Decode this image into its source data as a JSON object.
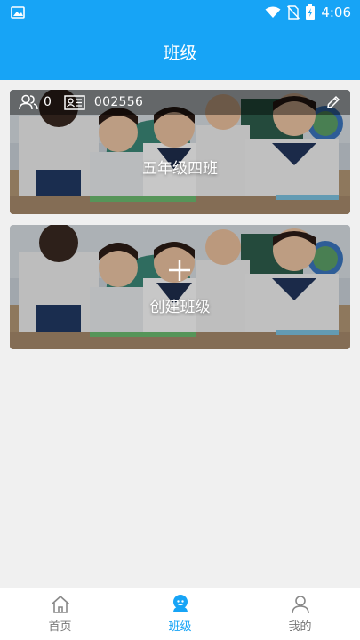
{
  "status_bar": {
    "time": "4:06",
    "icons": [
      "image-icon",
      "wifi-icon",
      "no-sim-icon",
      "battery-charging-icon"
    ]
  },
  "header": {
    "title": "班级"
  },
  "class_card": {
    "member_count": "0",
    "class_code": "002556",
    "class_name": "五年级四班",
    "icons": [
      "members-icon",
      "id-card-icon",
      "edit-icon"
    ]
  },
  "create_card": {
    "label": "创建班级",
    "icon": "plus-icon"
  },
  "bottom_nav": {
    "items": [
      {
        "label": "首页",
        "icon": "home-icon",
        "active": false
      },
      {
        "label": "班级",
        "icon": "class-icon",
        "active": true
      },
      {
        "label": "我的",
        "icon": "profile-icon",
        "active": false
      }
    ]
  },
  "colors": {
    "primary": "#17a4f6",
    "background": "#f0f0f0",
    "nav_inactive": "#777777"
  }
}
